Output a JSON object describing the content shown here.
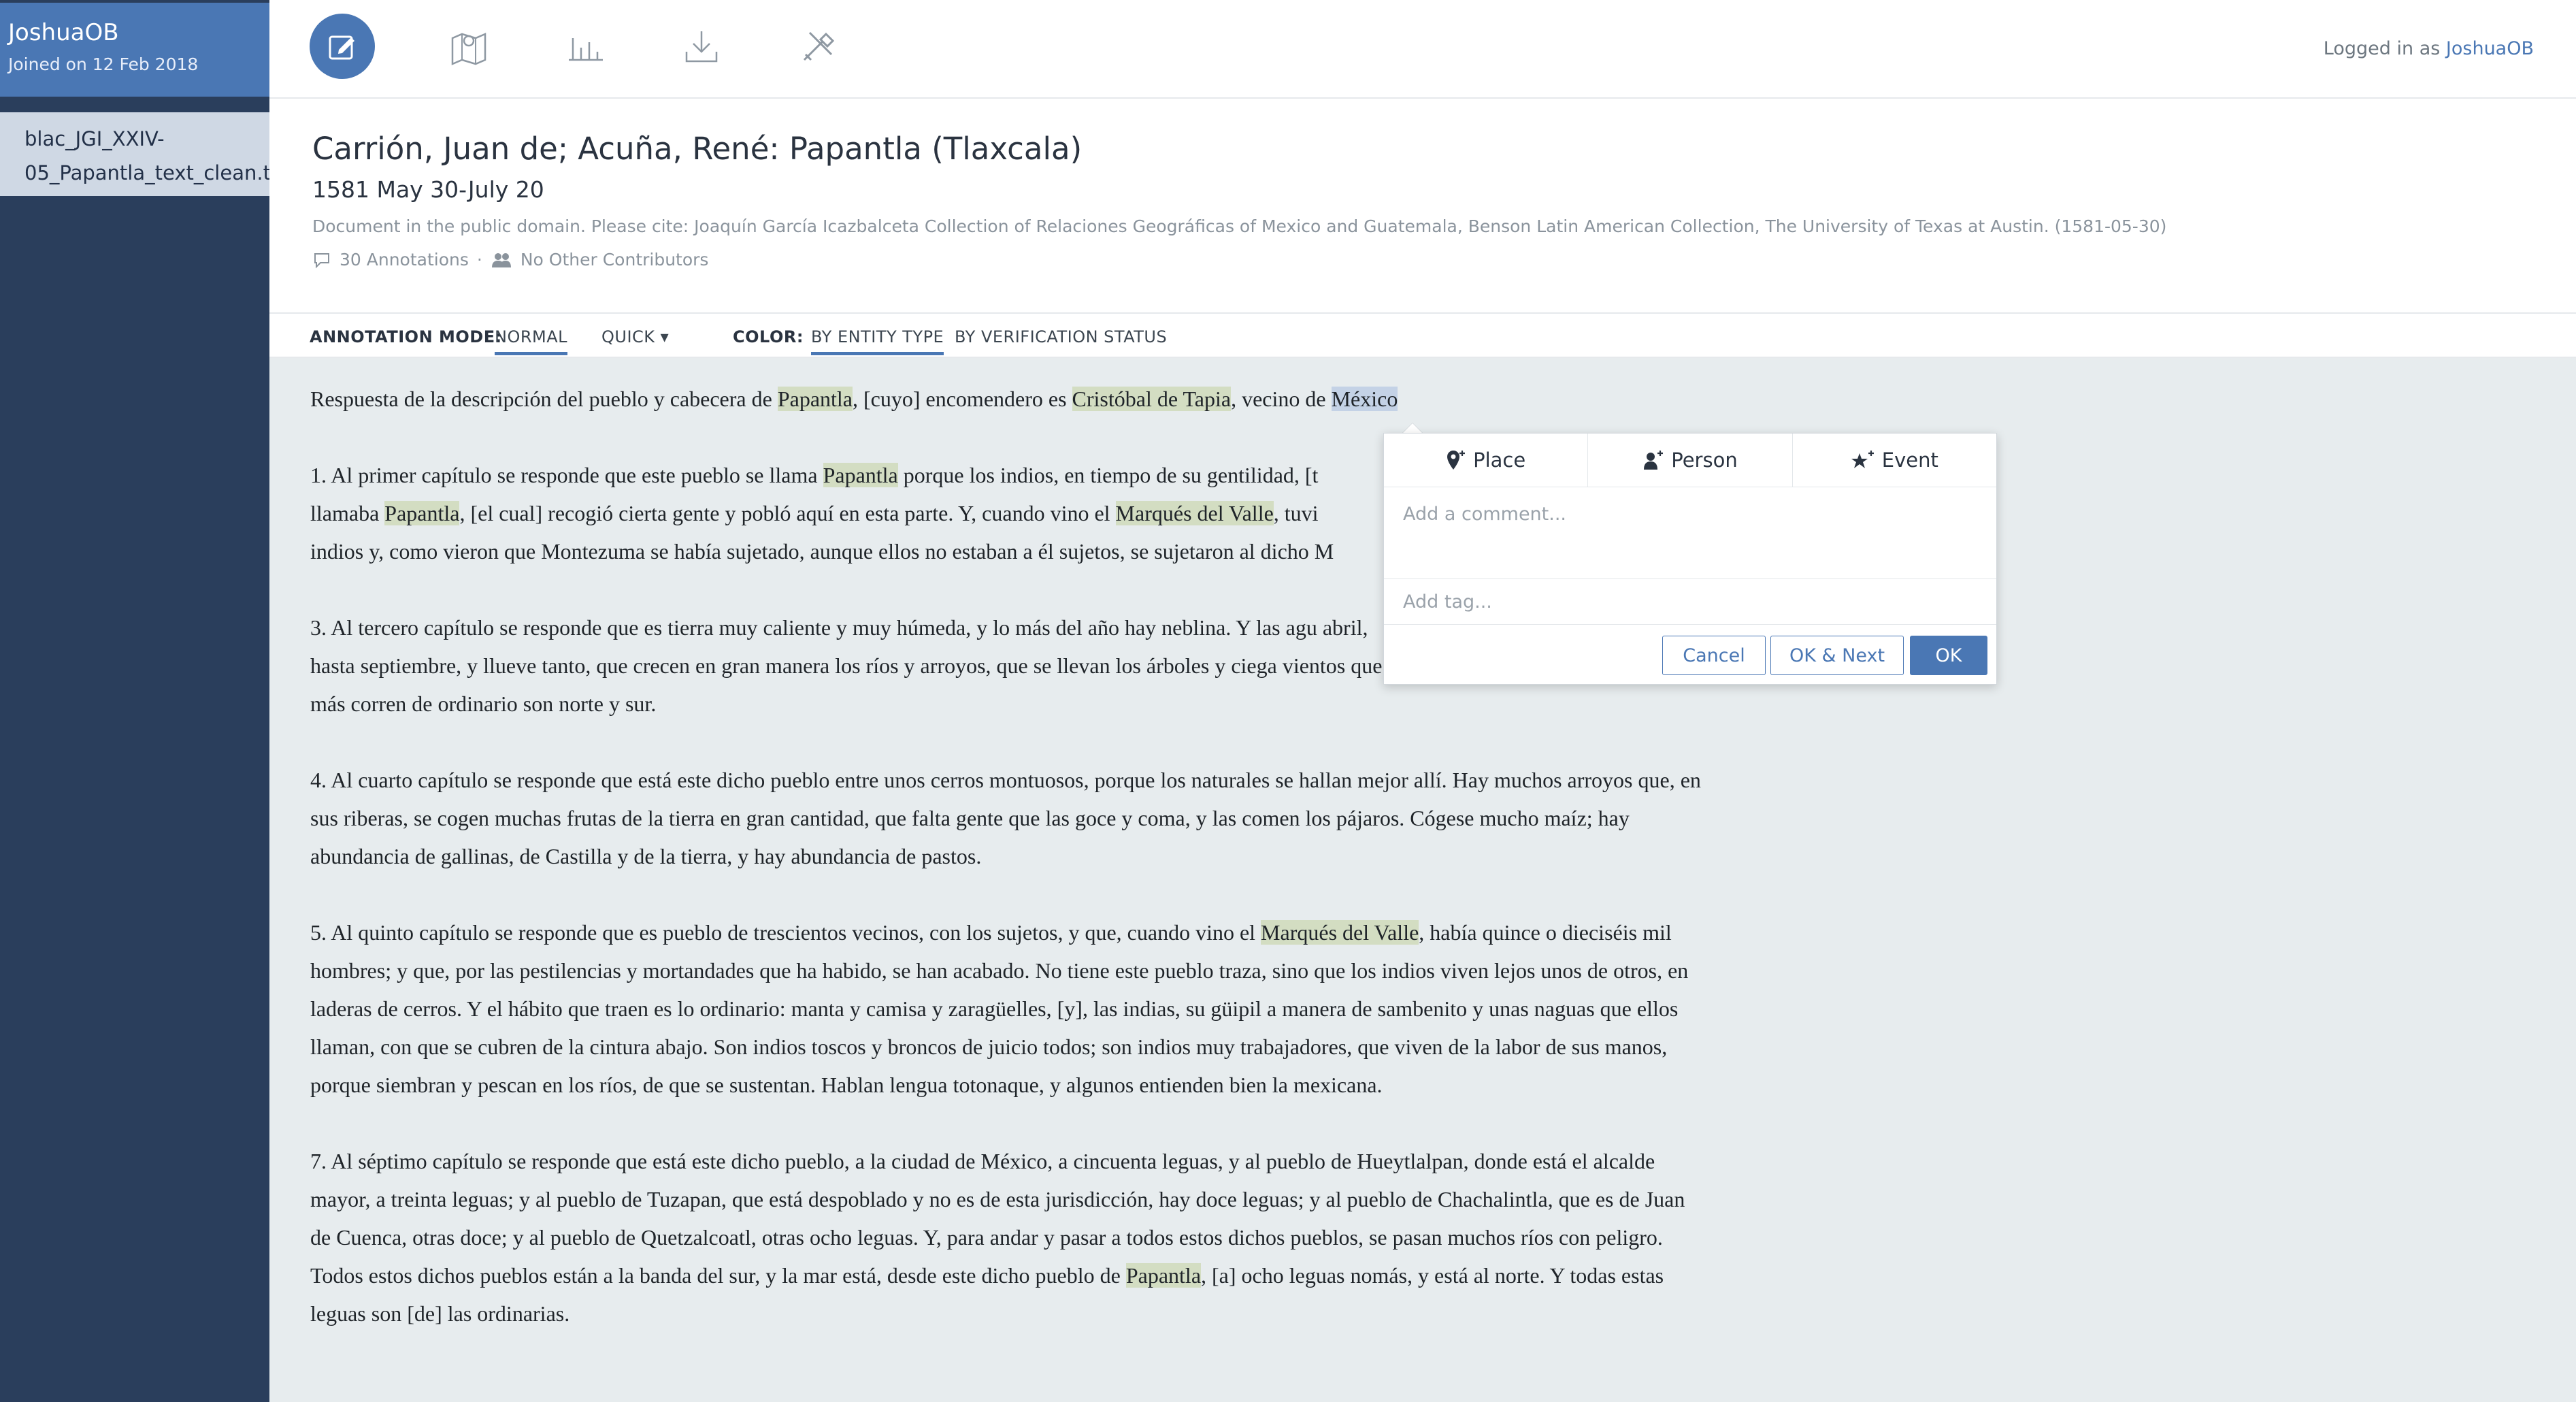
{
  "user": {
    "name": "JoshuaOB",
    "joined": "Joined on 12 Feb 2018"
  },
  "sidebar": {
    "document_name": "blac_JGI_XXIV-05_Papantla_text_clean.txt"
  },
  "toolbar": {
    "tools": [
      "edit-icon",
      "map-icon",
      "chart-icon",
      "download-icon",
      "settings-icon"
    ],
    "login_prefix": "Logged in as",
    "login_user": "JoshuaOB"
  },
  "document": {
    "title": "Carrión, Juan de; Acuña, René: Papantla (Tlaxcala)",
    "date": "1581 May 30-July 20",
    "citation": "Document in the public domain. Please cite: Joaquín García Icazbalceta Collection of Relaciones Geográficas of Mexico and Guatemala, Benson Latin American Collection, The University of Texas at Austin. (1581-05-30)",
    "annotations": "30 Annotations",
    "contributors": "No Other Contributors",
    "separator": "·"
  },
  "annotation_bar": {
    "mode_label": "ANNOTATION MODE:",
    "normal": "NORMAL",
    "quick": "QUICK",
    "color_label": "COLOR:",
    "by_entity": "BY ENTITY TYPE",
    "by_verification": "BY VERIFICATION STATUS"
  },
  "text": {
    "p0": [
      "Respuesta de la descripción del pueblo y cabecera de ",
      "Papantla",
      ", [cuyo] encomendero es ",
      "Cristóbal de Tapia",
      ", vecino de ",
      "México"
    ],
    "p1": [
      "1. Al primer capítulo se responde que este pueblo se llama ",
      "Papantla",
      " porque los indios, en tiempo de su gentilidad, [t",
      "llamaba ",
      "Papantla",
      ", [el cual] recogió cierta gente y pobló aquí en esta parte. Y, cuando vino el ",
      "Marqués del Valle",
      ", tuvi",
      "indios y, como vieron que Montezuma se había sujetado, aunque ellos no estaban a él sujetos, se sujetaron al dicho M"
    ],
    "p3": "3. Al tercero capítulo se responde que es tierra muy caliente y muy húmeda, y lo más del año hay neblina. Y las agu abril, hasta septiembre, y llueve tanto, que crecen en gran manera los ríos y arroyos, que se llevan los árboles y ciega vientos que más corren de ordinario son norte y sur.",
    "p4": "4. Al cuarto capítulo se responde que está este dicho pueblo entre unos cerros montuosos, porque los naturales se hallan mejor allí. Hay muchos arroyos que, en sus riberas, se cogen muchas frutas de la tierra en gran cantidad, que falta gente que las goce y coma, y las comen los pájaros. Cógese mucho maíz; hay abundancia de gallinas, de Castilla y de la tierra, y hay abundancia de pastos.",
    "p5": [
      "5. Al quinto capítulo se responde que es pueblo de trescientos vecinos, con los sujetos, y que, cuando vino el ",
      "Marqués del Valle",
      ", había quince o dieciséis mil hombres; y que, por las pestilencias y mortandades que ha habido, se han acabado. No tiene este pueblo traza, sino que los indios viven lejos unos de otros, en laderas de cerros. Y el hábito que traen es lo ordinario: manta y camisa y zaragüelles, [y], las indias, su güipil a manera de sambenito y unas naguas que ellos llaman, con que se cubren de la cintura abajo. Son indios toscos y broncos de juicio todos; son indios muy trabajadores, que viven de la labor de sus manos, porque siembran y pescan en los ríos, de que se sustentan. Hablan lengua totonaque, y algunos entienden bien la mexicana."
    ],
    "p7": [
      "7. Al séptimo capítulo se responde que está este dicho pueblo, a la ciudad de México, a cincuenta leguas, y al pueblo de Hueytlalpan, donde está el alcalde mayor, a treinta leguas; y al pueblo de Tuzapan, que está despoblado y no es de esta jurisdicción, hay doce leguas; y al pueblo de Chachalintla, que es de Juan de Cuenca, otras doce; y al pueblo de Quetzalcoatl, otras ocho leguas. Y, para andar y pasar a todos estos dichos pueblos, se pasan muchos ríos con peligro. Todos estos dichos pueblos están a la banda del sur, y la mar está, desde este dicho pueblo de ",
      "Papantla",
      ", [a] ocho leguas nomás, y está al norte. Y todas estas leguas son [de] las ordinarias."
    ]
  },
  "popup": {
    "tab_place": "Place",
    "tab_person": "Person",
    "tab_event": "Event",
    "comment_placeholder": "Add a comment...",
    "tag_placeholder": "Add tag...",
    "cancel": "Cancel",
    "ok_next": "OK & Next",
    "ok": "OK"
  },
  "colors": {
    "accent": "#4a77b4",
    "sidebar": "#2a3e5c",
    "highlight": "#d3ddc2",
    "selection": "#c4d2e6"
  }
}
